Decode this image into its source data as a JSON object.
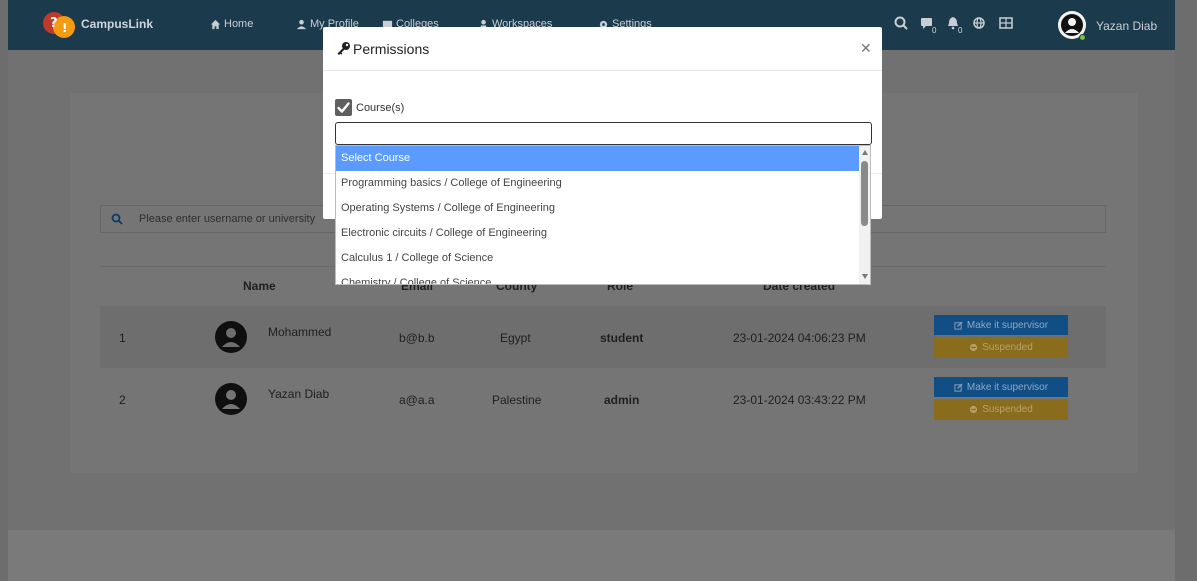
{
  "navbar": {
    "brand": "CampusLink",
    "links": [
      {
        "label": "Home",
        "icon": "home-icon"
      },
      {
        "label": "My Profile",
        "icon": "user-icon"
      },
      {
        "label": "Colleges",
        "icon": "building-icon"
      },
      {
        "label": "Workspaces",
        "icon": "users-icon"
      },
      {
        "label": "Settings",
        "icon": "gears-icon"
      }
    ],
    "right_icons": [
      "search-icon",
      "messages-icon",
      "bell-icon",
      "globe-icon",
      "language-icon"
    ],
    "messages_count": "0",
    "notifications_count": "0",
    "user_name": "Yazan Diab"
  },
  "page": {
    "search_placeholder": "Please enter username or university",
    "columns": [
      "Name",
      "Email",
      "County",
      "Role",
      "Date created"
    ],
    "rows": [
      {
        "index": "1",
        "name": "Mohammed",
        "email": "b@b.b",
        "country": "Egypt",
        "role": "student",
        "date": "23-01-2024 04:06:23 PM",
        "supervisor_label": "Make it supervisor",
        "suspended_label": "Suspended"
      },
      {
        "index": "2",
        "name": "Yazan Diab",
        "email": "a@a.a",
        "country": "Palestine",
        "role": "admin",
        "date": "23-01-2024 03:43:22 PM",
        "supervisor_label": "Make it supervisor",
        "suspended_label": "Suspended"
      }
    ]
  },
  "modal": {
    "title": "Permissions",
    "checkbox_label": "Course(s)",
    "checkbox_checked": true,
    "input_value": "",
    "options": [
      "Select Course",
      "Programming basics / College of Engineering",
      "Operating Systems / College of Engineering",
      "Electronic circuits / College of Engineering",
      "Calculus 1 / College of Science",
      "Chemistry / College of Science"
    ],
    "selected_option": "Select Course"
  },
  "colors": {
    "navbar": "#1b3a4c",
    "highlight": "#5b9bff",
    "supervisor_button": "#124e86",
    "suspended_button": "#8a6d1c"
  }
}
